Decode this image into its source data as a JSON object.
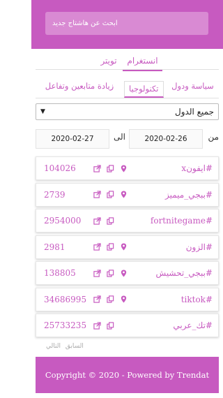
{
  "colors": {
    "accent": "#c75ac0",
    "accent_light": "#d98ad3"
  },
  "search": {
    "placeholder": "ابحث عن هاشتاج جديد"
  },
  "source_tabs": [
    {
      "label": "انستغرام",
      "active": true
    },
    {
      "label": "تويتر",
      "active": false
    }
  ],
  "category_tabs": [
    {
      "label": "سياسة ودول",
      "active": false
    },
    {
      "label": "تكنولوجيا",
      "active": true
    },
    {
      "label": "زيادة متابعين وتفاعل",
      "active": false
    }
  ],
  "country_select": {
    "selected": "جميع الدول"
  },
  "dates": {
    "from_label": "من",
    "from_value": "2020-02-26",
    "to_label": "الى",
    "to_value": "2020-02-27"
  },
  "hashtags": [
    {
      "name": "#ايفونx",
      "count": "104026",
      "has_location": true
    },
    {
      "name": "#ببجي_ميميز",
      "count": "2739",
      "has_location": true
    },
    {
      "name": "#fortnitegame",
      "count": "2954000",
      "has_location": false
    },
    {
      "name": "#الزون",
      "count": "2981",
      "has_location": true
    },
    {
      "name": "#ببجي_تحشيش",
      "count": "138805",
      "has_location": true
    },
    {
      "name": "#tiktok",
      "count": "34686995",
      "has_location": true
    },
    {
      "name": "#تك_عربي",
      "count": "25733235",
      "has_location": false
    }
  ],
  "pager": {
    "prev": "السابق",
    "next": "التالي"
  },
  "footer": {
    "text": "Copyright © 2020 - Powered by Trendat"
  },
  "icons": {
    "location": "map-pin-icon",
    "copy": "copy-icon",
    "external": "external-link-icon",
    "dropdown": "chevron-down-icon"
  }
}
